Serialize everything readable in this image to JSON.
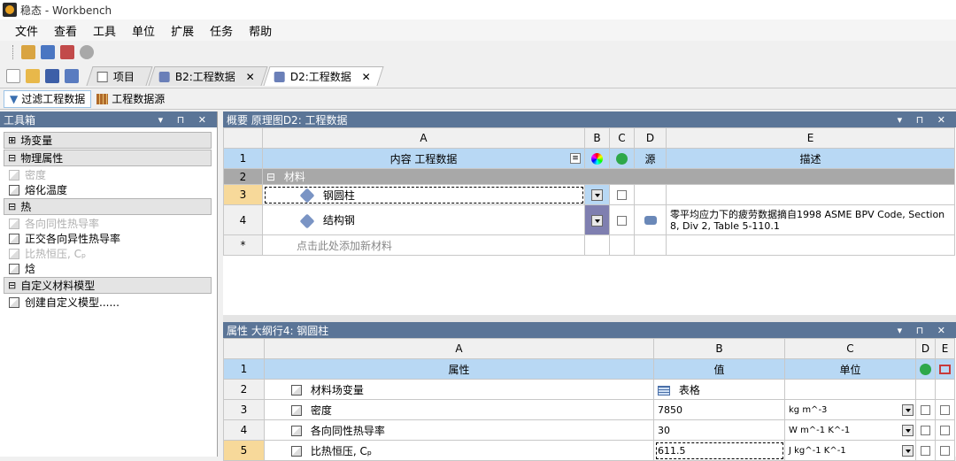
{
  "window": {
    "title": "稳态 - Workbench"
  },
  "menu": [
    "文件",
    "查看",
    "工具",
    "单位",
    "扩展",
    "任务",
    "帮助"
  ],
  "tabs": [
    {
      "label": "项目",
      "closable": false,
      "active": false
    },
    {
      "label": "B2:工程数据",
      "closable": true,
      "active": false
    },
    {
      "label": "D2:工程数据",
      "closable": true,
      "active": true
    }
  ],
  "tab_close": "✕",
  "filters": {
    "filter_label": "过滤工程数据",
    "source_label": "工程数据源"
  },
  "toolbox": {
    "title": "工具箱",
    "controls": "▾ ⊓ ✕",
    "groups": [
      {
        "label": "场变量",
        "expanded": false,
        "sym": "⊞",
        "items": []
      },
      {
        "label": "物理属性",
        "expanded": true,
        "sym": "⊟",
        "items": [
          {
            "label": "密度",
            "dim": true
          },
          {
            "label": "熔化温度",
            "dim": false
          }
        ]
      },
      {
        "label": "热",
        "expanded": true,
        "sym": "⊟",
        "items": [
          {
            "label": "各向同性热导率",
            "dim": true
          },
          {
            "label": "正交各向异性热导率",
            "dim": false
          },
          {
            "label": "比热恒压, Cₚ",
            "dim": true
          },
          {
            "label": "焓",
            "dim": false
          }
        ]
      },
      {
        "label": "自定义材料模型",
        "expanded": true,
        "sym": "⊟",
        "items": [
          {
            "label": "创建自定义模型......",
            "dim": false
          }
        ]
      }
    ]
  },
  "outline": {
    "title": "概要 原理图D2: 工程数据",
    "controls": "▾ ⊓ ✕",
    "columns": [
      "A",
      "B",
      "C",
      "D",
      "E"
    ],
    "header": {
      "num": "1",
      "a": "内容 工程数据",
      "d": "源",
      "e": "描述"
    },
    "section": {
      "num": "2",
      "label": "材料",
      "sym": "⊟"
    },
    "rows": [
      {
        "num": "3",
        "name": "钢圆柱",
        "desc": ""
      },
      {
        "num": "4",
        "name": "结构钢",
        "desc": "零平均应力下的疲劳数据摘自1998 ASME BPV Code, Section 8, Div 2, Table 5-110.1"
      }
    ],
    "add": {
      "num": "*",
      "label": "点击此处添加新材料"
    }
  },
  "properties": {
    "title": "属性 大纲行4: 钢圆柱",
    "controls": "▾ ⊓ ✕",
    "columns": [
      "A",
      "B",
      "C",
      "D",
      "E"
    ],
    "header": {
      "num": "1",
      "a": "属性",
      "b": "值",
      "c": "单位"
    },
    "rows": [
      {
        "num": "2",
        "name": "材料场变量",
        "value": "表格",
        "unit": ""
      },
      {
        "num": "3",
        "name": "密度",
        "value": "7850",
        "unit": "kg m^-3"
      },
      {
        "num": "4",
        "name": "各向同性热导率",
        "value": "30",
        "unit": "W m^-1 K^-1"
      },
      {
        "num": "5",
        "name": "比热恒压, Cₚ",
        "value": "611.5",
        "unit": "J kg^-1 K^-1"
      }
    ]
  }
}
